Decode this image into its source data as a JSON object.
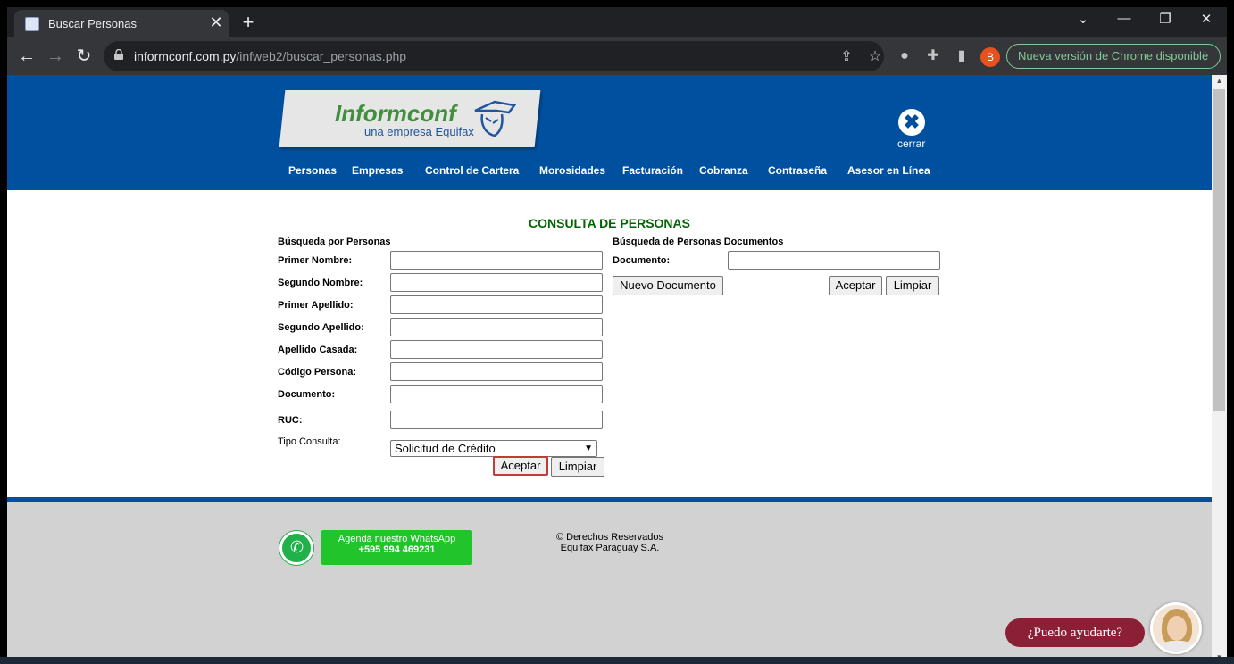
{
  "browser": {
    "tab_title": "Buscar Personas",
    "tab_close": "✕",
    "new_tab": "+",
    "url_domain": "informconf.com.py",
    "url_path": "/infweb2/buscar_personas.php",
    "profile_initial": "B",
    "update_label": "Nueva versión de Chrome disponible"
  },
  "header": {
    "logo_name": "Informconf",
    "logo_tagline": "una empresa Equifax",
    "close_label": "cerrar",
    "menu": [
      "Personas",
      "Empresas",
      "Control de Cartera",
      "Morosidades",
      "Facturación",
      "Cobranza",
      "Contraseña",
      "Asesor en Línea"
    ]
  },
  "page": {
    "title": "CONSULTA DE PERSONAS",
    "persons_section": {
      "heading": "Búsqueda por Personas",
      "fields": [
        {
          "label": "Primer Nombre:",
          "value": ""
        },
        {
          "label": "Segundo Nombre:",
          "value": ""
        },
        {
          "label": "Primer Apellido:",
          "value": ""
        },
        {
          "label": "Segundo Apellido:",
          "value": ""
        },
        {
          "label": "Apellido Casada:",
          "value": ""
        },
        {
          "label": "Código Persona:",
          "value": ""
        },
        {
          "label": "Documento:",
          "value": ""
        },
        {
          "label": "RUC:",
          "value": ""
        }
      ],
      "tipo_label": "Tipo Consulta:",
      "tipo_value": "Solicitud de Crédito",
      "accept_label": "Aceptar",
      "clear_label": "Limpiar"
    },
    "documents_section": {
      "heading": "Búsqueda de Personas Documentos",
      "document_label": "Documento:",
      "document_value": "",
      "new_document_label": "Nuevo Documento",
      "accept_label": "Aceptar",
      "clear_label": "Limpiar"
    }
  },
  "footer": {
    "whatsapp_line1": "Agendá nuestro WhatsApp",
    "whatsapp_line2": "+595 994 469231",
    "copyright_line1": "© Derechos Reservados",
    "copyright_line2": "Equifax Paraguay S.A."
  },
  "chat": {
    "help_label": "¿Puedo ayudarte?"
  },
  "colors": {
    "brand_blue": "#0050a0",
    "title_green": "#006400",
    "whatsapp_green": "#21c42a",
    "help_maroon": "#8a1f35"
  }
}
